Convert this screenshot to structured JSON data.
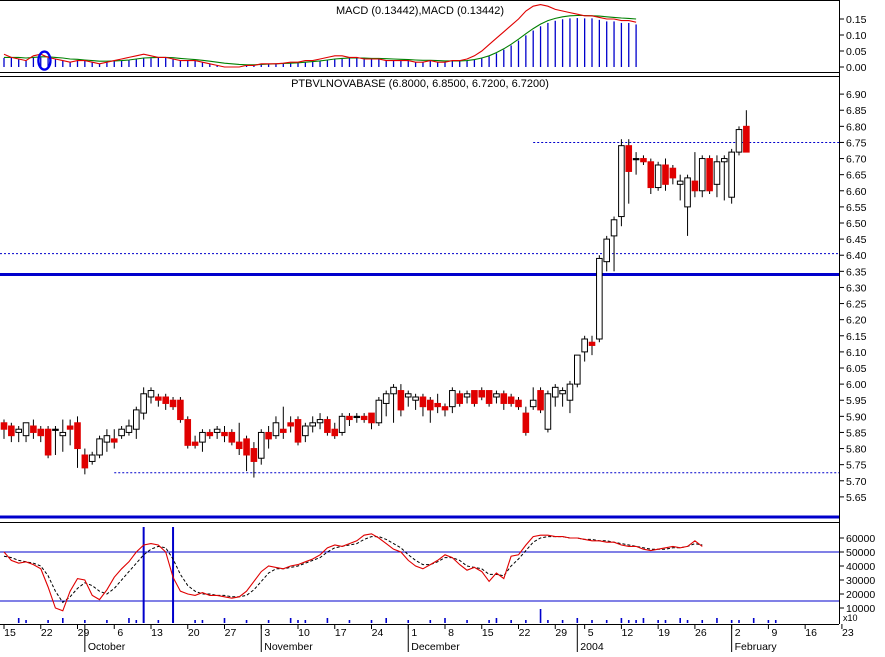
{
  "chart_data": [
    {
      "panel": "macd",
      "type": "line",
      "title": "MACD (0.13442),MACD (0.13442)",
      "ylim": [
        0,
        0.2
      ],
      "y_ticks": [
        "0.00",
        "0.05",
        "0.10",
        "0.15"
      ],
      "grid": false,
      "colors": {
        "macd": "#e00000",
        "signal": "#008000",
        "histogram": "#0000cc",
        "marker": "#0000ee"
      },
      "series": [
        {
          "style": "red-line",
          "values": [
            0.04,
            0.03,
            0.025,
            0.02,
            0.035,
            0.04,
            0.03,
            0.025,
            0.02,
            0.015,
            0.02,
            0.02,
            0.015,
            0.01,
            0.015,
            0.02,
            0.025,
            0.03,
            0.035,
            0.04,
            0.035,
            0.03,
            0.03,
            0.025,
            0.02,
            0.02,
            0.02,
            0.015,
            0.01,
            0.005,
            0.0,
            0.0,
            0.0,
            0.005,
            0.005,
            0.01,
            0.01,
            0.01,
            0.012,
            0.015,
            0.015,
            0.02,
            0.02,
            0.025,
            0.03,
            0.035,
            0.035,
            0.03,
            0.03,
            0.025,
            0.025,
            0.025,
            0.02,
            0.02,
            0.02,
            0.02,
            0.015,
            0.015,
            0.02,
            0.015,
            0.015,
            0.02,
            0.02,
            0.025,
            0.035,
            0.05,
            0.07,
            0.09,
            0.11,
            0.13,
            0.15,
            0.175,
            0.19,
            0.195,
            0.19,
            0.18,
            0.175,
            0.17,
            0.165,
            0.16,
            0.16,
            0.155,
            0.15,
            0.15,
            0.145,
            0.145,
            0.14
          ]
        },
        {
          "style": "green-line",
          "values": [
            0.03,
            0.03,
            0.03,
            0.028,
            0.03,
            0.032,
            0.032,
            0.03,
            0.028,
            0.025,
            0.024,
            0.022,
            0.02,
            0.018,
            0.018,
            0.019,
            0.02,
            0.022,
            0.025,
            0.028,
            0.029,
            0.03,
            0.03,
            0.029,
            0.027,
            0.025,
            0.023,
            0.021,
            0.018,
            0.015,
            0.012,
            0.01,
            0.008,
            0.007,
            0.007,
            0.008,
            0.009,
            0.01,
            0.011,
            0.012,
            0.013,
            0.015,
            0.017,
            0.019,
            0.022,
            0.025,
            0.027,
            0.028,
            0.028,
            0.028,
            0.027,
            0.027,
            0.026,
            0.025,
            0.024,
            0.023,
            0.022,
            0.021,
            0.021,
            0.02,
            0.019,
            0.019,
            0.019,
            0.02,
            0.023,
            0.028,
            0.035,
            0.045,
            0.057,
            0.071,
            0.087,
            0.104,
            0.12,
            0.134,
            0.145,
            0.152,
            0.157,
            0.16,
            0.161,
            0.161,
            0.16,
            0.159,
            0.157,
            0.155,
            0.153,
            0.152,
            0.15
          ]
        }
      ]
    },
    {
      "panel": "price",
      "type": "candlestick",
      "title": "PTBVLNOVABASE (6.8000, 6.8500, 6.7200, 6.7200)",
      "ylim": [
        5.6,
        6.95
      ],
      "y_ticks": [
        "5.65",
        "5.70",
        "5.75",
        "5.80",
        "5.85",
        "5.90",
        "5.95",
        "6.00",
        "6.05",
        "6.10",
        "6.15",
        "6.20",
        "6.25",
        "6.30",
        "6.35",
        "6.40",
        "6.45",
        "6.50",
        "6.55",
        "6.60",
        "6.65",
        "6.70",
        "6.75",
        "6.80",
        "6.85",
        "6.90"
      ],
      "horizontal_lines": [
        {
          "style": "dotted",
          "value": 6.75,
          "from_index": 72
        },
        {
          "style": "dotted",
          "value": 6.405
        },
        {
          "style": "solid-thick",
          "value": 6.34
        },
        {
          "style": "dotted",
          "value": 5.725,
          "from_index": 15
        }
      ],
      "colors": {
        "up": "#ffffff",
        "down": "#e00000",
        "outline": "#000000",
        "level": "#0000cc"
      },
      "candles": [
        [
          5.88,
          5.89,
          5.83,
          5.86
        ],
        [
          5.87,
          5.88,
          5.82,
          5.84
        ],
        [
          5.85,
          5.87,
          5.82,
          5.86
        ],
        [
          5.84,
          5.88,
          5.82,
          5.88
        ],
        [
          5.87,
          5.89,
          5.83,
          5.85
        ],
        [
          5.86,
          5.87,
          5.82,
          5.84
        ],
        [
          5.86,
          5.87,
          5.77,
          5.78
        ],
        [
          5.86,
          5.87,
          5.78,
          5.86
        ],
        [
          5.84,
          5.89,
          5.79,
          5.85
        ],
        [
          5.87,
          5.89,
          5.81,
          5.86
        ],
        [
          5.88,
          5.9,
          5.74,
          5.8
        ],
        [
          5.78,
          5.8,
          5.72,
          5.74
        ],
        [
          5.76,
          5.79,
          5.75,
          5.78
        ],
        [
          5.78,
          5.84,
          5.77,
          5.83
        ],
        [
          5.82,
          5.86,
          5.79,
          5.84
        ],
        [
          5.83,
          5.86,
          5.8,
          5.82
        ],
        [
          5.84,
          5.87,
          5.83,
          5.86
        ],
        [
          5.85,
          5.89,
          5.84,
          5.87
        ],
        [
          5.86,
          5.93,
          5.83,
          5.92
        ],
        [
          5.91,
          5.99,
          5.89,
          5.97
        ],
        [
          5.96,
          5.99,
          5.94,
          5.98
        ],
        [
          5.96,
          5.97,
          5.93,
          5.95
        ],
        [
          5.96,
          5.97,
          5.92,
          5.94
        ],
        [
          5.95,
          5.96,
          5.92,
          5.93
        ],
        [
          5.95,
          5.96,
          5.88,
          5.89
        ],
        [
          5.89,
          5.9,
          5.8,
          5.81
        ],
        [
          5.82,
          5.84,
          5.8,
          5.81
        ],
        [
          5.82,
          5.86,
          5.79,
          5.85
        ],
        [
          5.85,
          5.86,
          5.83,
          5.84
        ],
        [
          5.85,
          5.87,
          5.83,
          5.86
        ],
        [
          5.85,
          5.87,
          5.82,
          5.84
        ],
        [
          5.85,
          5.86,
          5.81,
          5.82
        ],
        [
          5.82,
          5.88,
          5.78,
          5.8
        ],
        [
          5.83,
          5.84,
          5.73,
          5.78
        ],
        [
          5.8,
          5.82,
          5.71,
          5.76
        ],
        [
          5.77,
          5.86,
          5.75,
          5.85
        ],
        [
          5.85,
          5.87,
          5.8,
          5.83
        ],
        [
          5.84,
          5.9,
          5.83,
          5.88
        ],
        [
          5.86,
          5.93,
          5.83,
          5.85
        ],
        [
          5.88,
          5.9,
          5.85,
          5.87
        ],
        [
          5.89,
          5.9,
          5.81,
          5.82
        ],
        [
          5.84,
          5.88,
          5.82,
          5.87
        ],
        [
          5.87,
          5.9,
          5.85,
          5.88
        ],
        [
          5.88,
          5.91,
          5.86,
          5.89
        ],
        [
          5.89,
          5.9,
          5.84,
          5.85
        ],
        [
          5.86,
          5.88,
          5.83,
          5.84
        ],
        [
          5.85,
          5.91,
          5.84,
          5.9
        ],
        [
          5.9,
          5.91,
          5.87,
          5.89
        ],
        [
          5.9,
          5.91,
          5.88,
          5.9
        ],
        [
          5.9,
          5.91,
          5.88,
          5.89
        ],
        [
          5.91,
          5.91,
          5.86,
          5.88
        ],
        [
          5.88,
          5.96,
          5.87,
          5.95
        ],
        [
          5.94,
          5.98,
          5.9,
          5.97
        ],
        [
          5.97,
          6.0,
          5.88,
          5.99
        ],
        [
          5.98,
          6.0,
          5.9,
          5.92
        ],
        [
          5.96,
          5.98,
          5.93,
          5.97
        ],
        [
          5.95,
          5.97,
          5.92,
          5.96
        ],
        [
          5.96,
          5.97,
          5.9,
          5.93
        ],
        [
          5.95,
          5.96,
          5.88,
          5.92
        ],
        [
          5.94,
          5.97,
          5.91,
          5.93
        ],
        [
          5.93,
          5.94,
          5.9,
          5.92
        ],
        [
          5.93,
          5.99,
          5.91,
          5.98
        ],
        [
          5.97,
          5.98,
          5.93,
          5.94
        ],
        [
          5.96,
          5.98,
          5.94,
          5.97
        ],
        [
          5.98,
          5.98,
          5.93,
          5.94
        ],
        [
          5.98,
          5.99,
          5.95,
          5.96
        ],
        [
          5.98,
          5.98,
          5.93,
          5.94
        ],
        [
          5.96,
          5.98,
          5.94,
          5.97
        ],
        [
          5.97,
          5.98,
          5.92,
          5.94
        ],
        [
          5.96,
          5.97,
          5.93,
          5.94
        ],
        [
          5.95,
          5.96,
          5.92,
          5.93
        ],
        [
          5.91,
          5.93,
          5.84,
          5.85
        ],
        [
          5.93,
          5.99,
          5.92,
          5.95
        ],
        [
          5.98,
          5.99,
          5.91,
          5.92
        ],
        [
          5.86,
          5.98,
          5.85,
          5.97
        ],
        [
          5.96,
          6.0,
          5.93,
          5.99
        ],
        [
          5.97,
          5.99,
          5.93,
          5.98
        ],
        [
          5.95,
          6.01,
          5.91,
          6.0
        ],
        [
          6.0,
          6.09,
          5.99,
          6.09
        ],
        [
          6.1,
          6.15,
          6.07,
          6.14
        ],
        [
          6.13,
          6.15,
          6.09,
          6.12
        ],
        [
          6.14,
          6.4,
          6.13,
          6.39
        ],
        [
          6.38,
          6.46,
          6.35,
          6.45
        ],
        [
          6.46,
          6.52,
          6.35,
          6.51
        ],
        [
          6.52,
          6.76,
          6.49,
          6.74
        ],
        [
          6.74,
          6.76,
          6.56,
          6.66
        ],
        [
          6.7,
          6.72,
          6.65,
          6.7
        ],
        [
          6.7,
          6.71,
          6.68,
          6.69
        ],
        [
          6.69,
          6.7,
          6.59,
          6.61
        ],
        [
          6.61,
          6.69,
          6.6,
          6.68
        ],
        [
          6.68,
          6.7,
          6.6,
          6.62
        ],
        [
          6.67,
          6.68,
          6.62,
          6.64
        ],
        [
          6.62,
          6.65,
          6.57,
          6.63
        ],
        [
          6.55,
          6.65,
          6.46,
          6.64
        ],
        [
          6.63,
          6.72,
          6.58,
          6.6
        ],
        [
          6.6,
          6.71,
          6.58,
          6.7
        ],
        [
          6.7,
          6.71,
          6.59,
          6.6
        ],
        [
          6.62,
          6.71,
          6.58,
          6.69
        ],
        [
          6.69,
          6.71,
          6.57,
          6.7
        ],
        [
          6.58,
          6.73,
          6.56,
          6.72
        ],
        [
          6.72,
          6.8,
          6.71,
          6.79
        ],
        [
          6.8,
          6.85,
          6.72,
          6.72
        ]
      ]
    },
    {
      "panel": "volume",
      "type": "line",
      "unit": "x10",
      "ylim": [
        0,
        70000
      ],
      "y_ticks": [
        "10000",
        "20000",
        "30000",
        "40000",
        "50000",
        "60000"
      ],
      "horizontal_lines": [
        50000,
        15000
      ],
      "vertical_markers": [
        19,
        23
      ],
      "colors": {
        "line": "#e00000",
        "average": "#000000",
        "bars": "#0000cc",
        "level": "#0000cc"
      },
      "series": [
        {
          "style": "red-line",
          "values": [
            50000,
            44000,
            42000,
            43000,
            41000,
            38000,
            25000,
            10000,
            8000,
            22000,
            31000,
            30000,
            19000,
            16000,
            23000,
            32000,
            38000,
            43000,
            50000,
            55000,
            56000,
            55000,
            50000,
            32000,
            22000,
            20000,
            19000,
            21000,
            19000,
            19000,
            18000,
            17000,
            18000,
            22000,
            29000,
            36000,
            40000,
            39000,
            38000,
            40000,
            41000,
            43000,
            45000,
            48000,
            53000,
            55000,
            54000,
            56000,
            58000,
            62000,
            63000,
            60000,
            56000,
            52000,
            50000,
            44000,
            40000,
            38000,
            41000,
            44000,
            48000,
            46000,
            41000,
            37000,
            39000,
            36000,
            29000,
            35000,
            31000,
            47000,
            48000,
            55000,
            61000,
            62000,
            62000,
            61000,
            61000,
            60000,
            60000,
            59000,
            58000,
            58000,
            57000,
            57000,
            55000,
            54000,
            54000,
            52000,
            51000,
            52000,
            53000,
            54000,
            53000,
            54000,
            58000,
            54000
          ]
        },
        {
          "style": "dashed-line",
          "values": [
            47000,
            46000,
            44000,
            43000,
            42000,
            40000,
            33000,
            22000,
            14000,
            18000,
            24000,
            28000,
            26000,
            22000,
            20000,
            24000,
            30000,
            36000,
            42000,
            48000,
            52000,
            54000,
            53000,
            45000,
            34000,
            26000,
            22000,
            20000,
            20000,
            19000,
            19000,
            18000,
            18000,
            19000,
            23000,
            29000,
            35000,
            38000,
            38000,
            39000,
            40000,
            42000,
            44000,
            46000,
            50000,
            53000,
            54000,
            55000,
            56000,
            59000,
            61000,
            61000,
            59000,
            56000,
            53000,
            48000,
            44000,
            41000,
            41000,
            43000,
            46000,
            46000,
            44000,
            40000,
            39000,
            38000,
            34000,
            34000,
            33000,
            40000,
            45000,
            51000,
            57000,
            60000,
            61000,
            61000,
            61000,
            60000,
            60000,
            59000,
            59000,
            58000,
            58000,
            57000,
            56000,
            55000,
            54000,
            53000,
            52000,
            52000,
            52000,
            53000,
            53000,
            54000,
            56000,
            55000
          ]
        }
      ]
    }
  ],
  "x_axis": {
    "day_ticks": [
      {
        "label": "15",
        "index": 0
      },
      {
        "label": "22",
        "index": 5
      },
      {
        "label": "29",
        "index": 10
      },
      {
        "label": "6",
        "index": 15
      },
      {
        "label": "13",
        "index": 20
      },
      {
        "label": "20",
        "index": 25
      },
      {
        "label": "27",
        "index": 30
      },
      {
        "label": "3",
        "index": 35
      },
      {
        "label": "10",
        "index": 40
      },
      {
        "label": "17",
        "index": 45
      },
      {
        "label": "24",
        "index": 50
      },
      {
        "label": "1",
        "index": 55
      },
      {
        "label": "8",
        "index": 60
      },
      {
        "label": "15",
        "index": 65
      },
      {
        "label": "22",
        "index": 70
      },
      {
        "label": "29",
        "index": 75
      },
      {
        "label": "5",
        "index": 79
      },
      {
        "label": "12",
        "index": 84
      },
      {
        "label": "19",
        "index": 89
      },
      {
        "label": "26",
        "index": 94
      },
      {
        "label": "2",
        "index": 99
      },
      {
        "label": "9",
        "index": 104
      },
      {
        "label": "16",
        "index": 109
      },
      {
        "label": "23",
        "index": 114
      }
    ],
    "month_ticks": [
      {
        "label": "October",
        "index": 11
      },
      {
        "label": "November",
        "index": 35
      },
      {
        "label": "December",
        "index": 55
      },
      {
        "label": "2004",
        "index": 78
      },
      {
        "label": "February",
        "index": 99
      }
    ]
  }
}
